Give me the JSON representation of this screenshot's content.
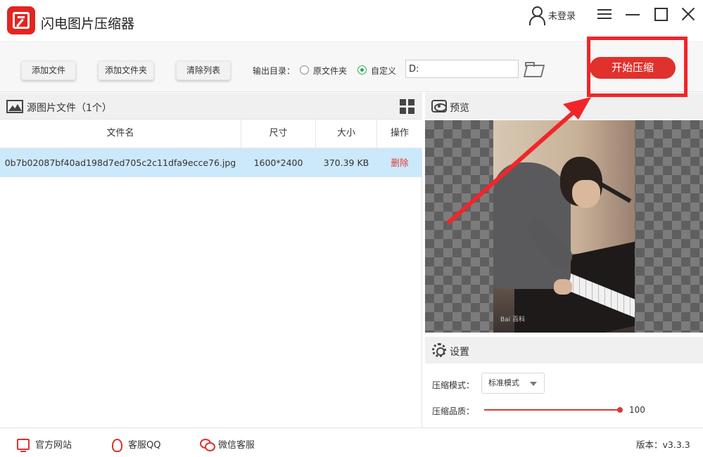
{
  "app": {
    "title": "闪电图片压缩器",
    "user_label": "未登录"
  },
  "toolbar": {
    "add_file": "添加文件",
    "add_folder": "添加文件夹",
    "clear_list": "清除列表",
    "output_label": "输出目录：",
    "option_original": "原文件夹",
    "option_custom": "自定义",
    "output_path": "D:",
    "start_button": "开始压缩",
    "selected_option": "自定义"
  },
  "file_panel": {
    "title": "源图片文件（1个）",
    "columns": [
      "文件名",
      "尺寸",
      "大小",
      "操作"
    ],
    "rows": [
      {
        "name": "0b7b02087bf40ad198d7ed705c2c11dfa9ecce76.jpg",
        "dimensions": "1600*2400",
        "size": "370.39 KB",
        "action": "删除"
      }
    ]
  },
  "preview_panel": {
    "title": "预览",
    "watermark": "Bai 百科"
  },
  "settings_panel": {
    "title": "设置",
    "mode_label": "压缩模式：",
    "mode_value": "标准模式",
    "quality_label": "压缩品质：",
    "quality_value": "100",
    "quality_fraction": 1.0
  },
  "footer": {
    "website": "官方网站",
    "qq": "客服QQ",
    "wechat": "微信客服",
    "version": "版本：v3.3.3"
  },
  "colors": {
    "accent_red": "#e0312c",
    "row_selected": "#cce8fb",
    "radio_green": "#2fa84f"
  },
  "icons": {
    "logo": "logo-icon",
    "user": "user-icon",
    "menu": "menu-icon",
    "minimize": "minimize-icon",
    "maximize": "maximize-icon",
    "close": "close-icon",
    "folder": "folder-open-icon",
    "image": "image-icon",
    "grid": "grid-view-icon",
    "eye": "eye-icon",
    "gear": "gear-icon",
    "monitor": "monitor-icon",
    "qq": "qq-icon",
    "wechat": "wechat-icon"
  }
}
